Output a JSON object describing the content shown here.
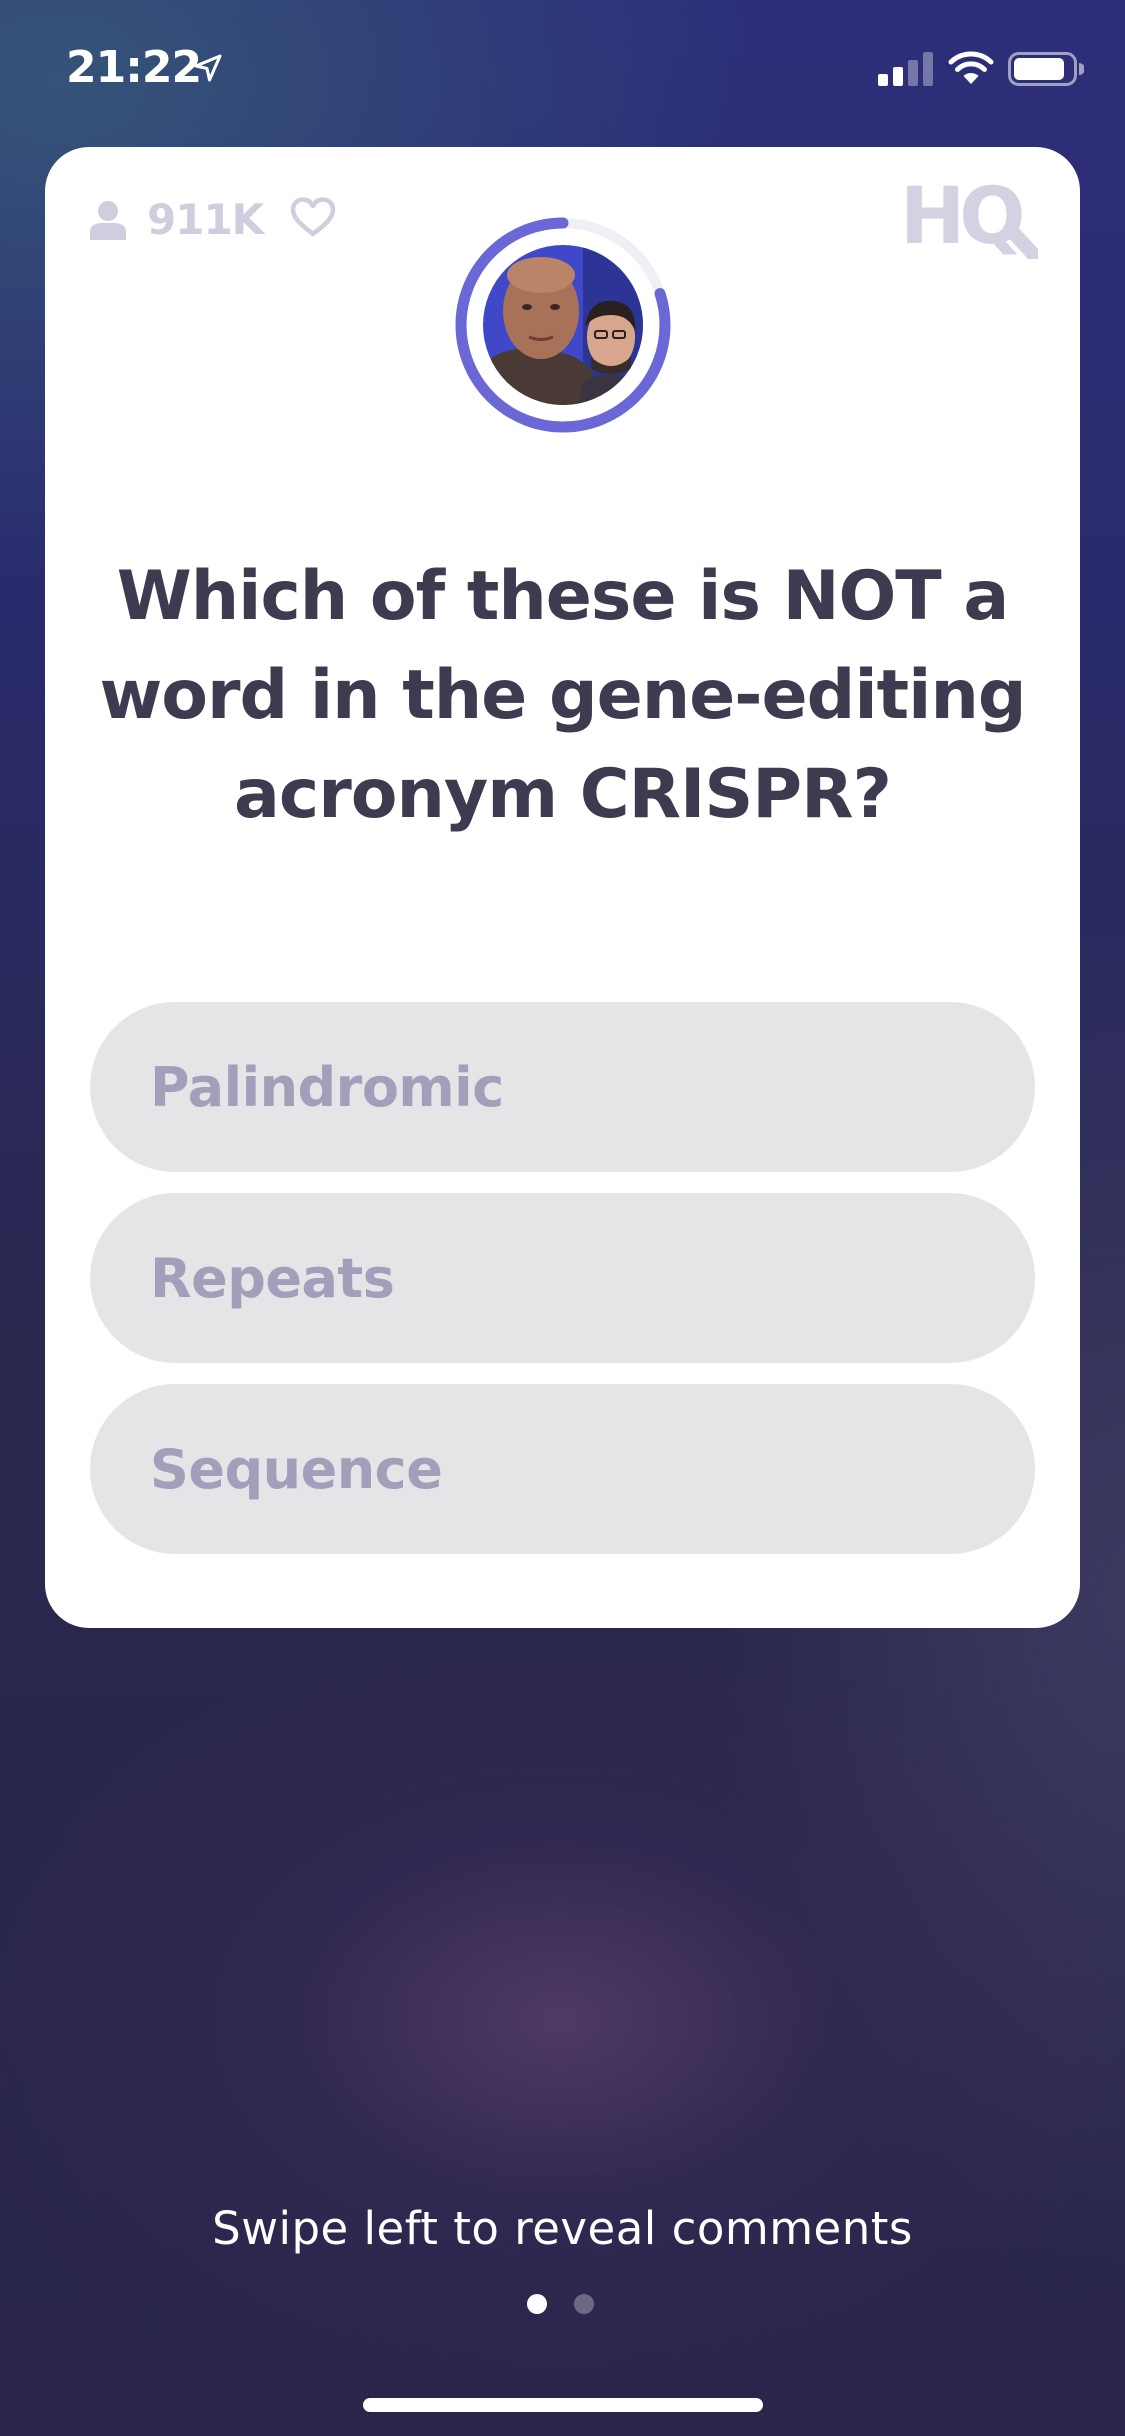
{
  "status_bar": {
    "time": "21:22",
    "icons": [
      "location-arrow-icon",
      "cellular-signal-icon",
      "wifi-icon",
      "battery-icon"
    ]
  },
  "card": {
    "viewer_count": "911K",
    "logo_text": "HQ",
    "icons": [
      "user-icon",
      "heart-icon"
    ],
    "timer": {
      "remaining_fraction": 0.8,
      "color": "#6a68d6"
    },
    "question": "Which of these is NOT a word in the gene-editing acronym CRISPR?",
    "answers": [
      "Palindromic",
      "Repeats",
      "Sequence"
    ]
  },
  "footer": {
    "swipe_hint": "Swipe left to reveal comments",
    "page_count": 2,
    "active_page": 1
  },
  "colors": {
    "question_text": "#3c3b50",
    "answer_bg": "#e5e4e7",
    "answer_text": "#a19fba",
    "muted_icon": "#cfcdde",
    "accent": "#6a68d6"
  }
}
